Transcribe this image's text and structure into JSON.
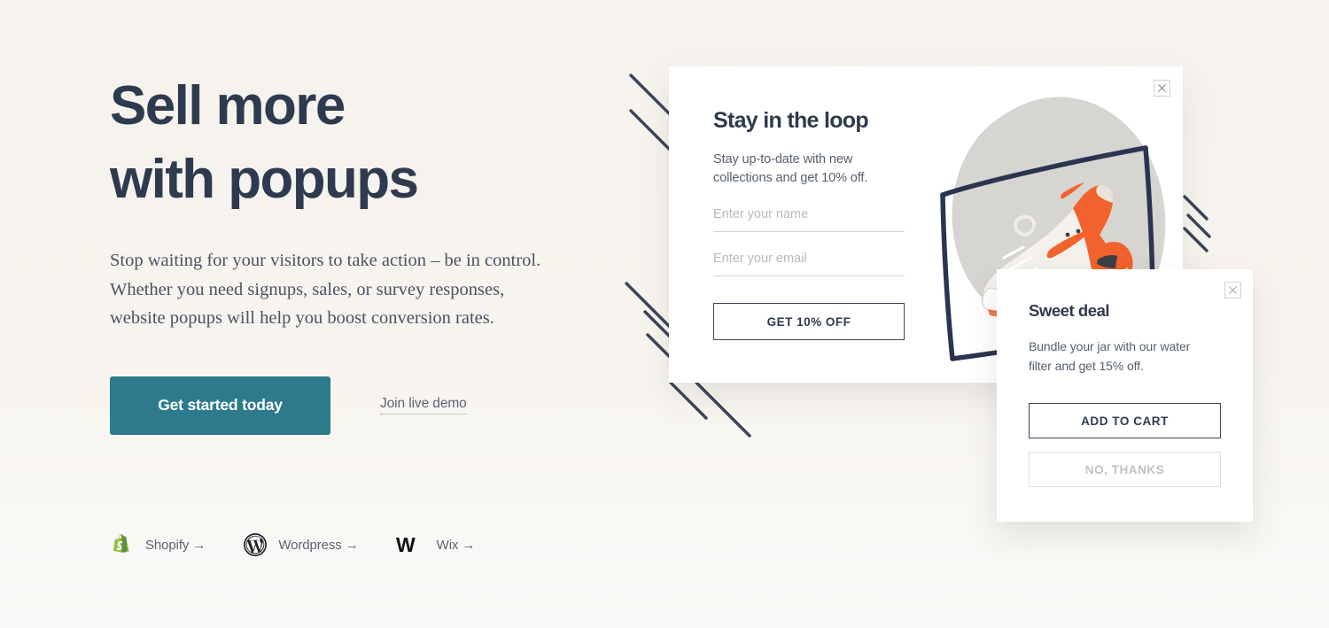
{
  "theme": {
    "background": "#f6f2ed",
    "ink": "#2e3a4e",
    "accent_teal": "#2d7a8d",
    "muted": "#565f6f",
    "placeholder": "#b9b9bb",
    "shopify_green": "#95bf47",
    "wordpress_dark": "#21212a",
    "wix_black": "#111111",
    "shoe_orange": "#f2622c",
    "blob_grey": "#d6d4d0"
  },
  "hero": {
    "headline": "Sell more\nwith popups",
    "subcopy": "Stop waiting for your visitors to take action – be in control.\nWhether you need signups, sales, or survey responses,\nwebsite popups will help you boost conversion rates.",
    "primary_cta": "Get started today",
    "secondary_cta": "Join live demo"
  },
  "platforms": [
    {
      "name": "Shopify",
      "label": "Shopify →",
      "icon": "shopify-icon"
    },
    {
      "name": "Wordpress",
      "label": "Wordpress →",
      "icon": "wordpress-icon"
    },
    {
      "name": "Wix",
      "label": "Wix →",
      "icon": "wix-icon"
    }
  ],
  "popup_newsletter": {
    "title": "Stay in the loop",
    "subtitle": "Stay up-to-date with new\ncollections and get 10% off.",
    "name_placeholder": "Enter your name",
    "name_value": "",
    "email_placeholder": "Enter your email",
    "email_value": "",
    "submit_label": "GET 10% OFF",
    "close_icon": "close-icon",
    "product_image": "nike-sneaker-white-orange"
  },
  "popup_upsell": {
    "title": "Sweet deal",
    "subtitle": "Bundle your jar with our water\nfilter and get 15% off.",
    "primary_label": "ADD TO CART",
    "secondary_label": "NO, THANKS",
    "close_icon": "close-icon"
  }
}
